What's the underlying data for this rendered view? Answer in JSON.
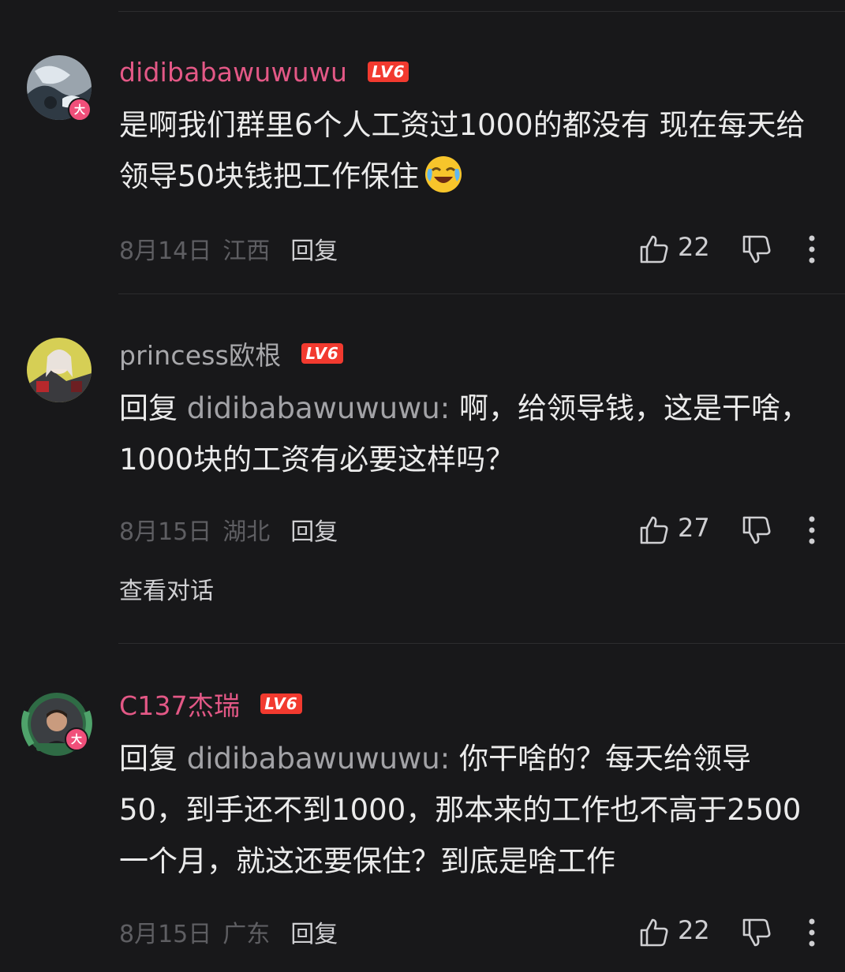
{
  "comments": [
    {
      "username": "didibabawuwuwu",
      "level": "LV6",
      "vip_badge": "大",
      "text": "是啊我们群里6个人工资过1000的都没有 现在每天给领导50块钱把工作保住",
      "emoji": "crying-laughing-emoji",
      "date": "8月14日",
      "location": "江西",
      "reply_label": "回复",
      "likes": "22"
    },
    {
      "username": "princess欧根",
      "level": "LV6",
      "reply_prefix": "回复",
      "reply_target": "didibabawuwuwu:",
      "text": "啊，给领导钱，这是干啥，1000块的工资有必要这样吗？",
      "date": "8月15日",
      "location": "湖北",
      "reply_label": "回复",
      "likes": "27",
      "view_thread": "查看对话"
    },
    {
      "username": "C137杰瑞",
      "level": "LV6",
      "vip_badge": "大",
      "reply_prefix": "回复",
      "reply_target": "didibabawuwuwu:",
      "text": "你干啥的？每天给领导50，到手还不到1000，那本来的工作也不高于2500一个月，就这还要保住？到底是啥工作",
      "date": "8月15日",
      "location": "广东",
      "reply_label": "回复",
      "likes": "22"
    }
  ],
  "colors": {
    "background": "#18181a",
    "username_pink": "#e35886",
    "username_gray": "#a8a8ab",
    "level_badge": "#f23a2f"
  }
}
